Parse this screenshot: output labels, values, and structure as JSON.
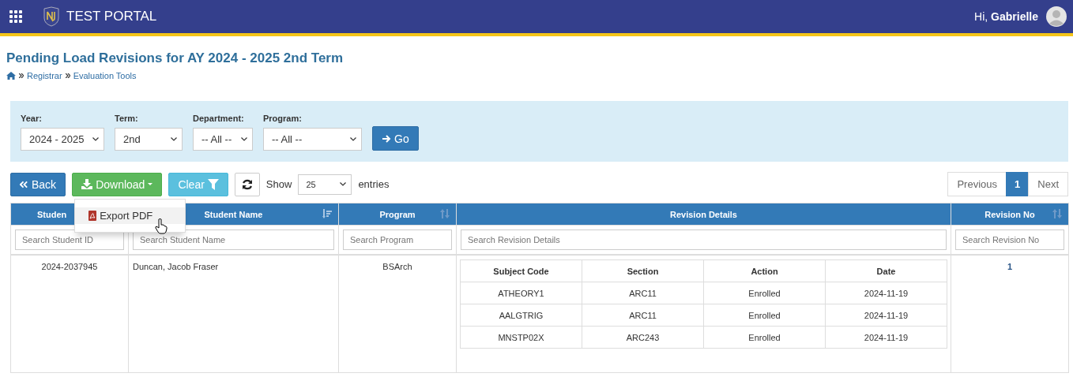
{
  "header": {
    "title": "TEST PORTAL",
    "greeting": "Hi, **Gabrielle**"
  },
  "page": {
    "title": "Pending Load Revisions for AY 2024 - 2025 2nd Term",
    "breadcrumb": [
      "Registrar",
      "Evaluation Tools"
    ]
  },
  "filters": [
    {
      "label": "Year:",
      "value": "2024 - 2025"
    },
    {
      "label": "Term:",
      "value": "2nd"
    },
    {
      "label": "Department:",
      "value": "-- All --"
    },
    {
      "label": "Program:",
      "value": "-- All --"
    }
  ],
  "go_button": "Go",
  "toolbar": {
    "back": "Back",
    "download": "Download",
    "clear": "Clear",
    "show": "Show",
    "entries_value": "25",
    "entries": "entries"
  },
  "download_menu": {
    "expanded": true,
    "items": [
      {
        "label": "Export PDF",
        "highlighted": true
      }
    ]
  },
  "pagination": [
    {
      "label": "Previous",
      "selected": false
    },
    {
      "label": "1",
      "selected": true
    },
    {
      "label": "Next",
      "selected": false
    }
  ],
  "table": {
    "columns": [
      {
        "label": "Studen",
        "placeholder": "Search Student ID"
      },
      {
        "label": "Student Name",
        "sortable": true,
        "sorted": true,
        "placeholder": "Search Student Name"
      },
      {
        "label": "Program",
        "sortable": true,
        "sorted": false,
        "placeholder": "Search Program"
      },
      {
        "label": "Revision Details",
        "placeholder": "Search Revision Details"
      },
      {
        "label": "Revision No",
        "sortable": true,
        "sorted": false,
        "placeholder": "Search Revision No"
      }
    ],
    "rows": [
      {
        "student_id": "2024-2037945",
        "student_name": "Duncan, Jacob Fraser",
        "program": "BSArch",
        "revision_no": "1",
        "revision_details": {
          "columns": [
            "Subject Code",
            "Section",
            "Action",
            "Date"
          ],
          "rows": [
            [
              "ATHEORY1",
              "ARC11",
              "Enrolled",
              "2024-11-19"
            ],
            [
              "AALGTRIG",
              "ARC11",
              "Enrolled",
              "2024-11-19"
            ],
            [
              "MNSTP02X",
              "ARC243",
              "Enrolled",
              "2024-11-19"
            ]
          ]
        }
      }
    ]
  }
}
